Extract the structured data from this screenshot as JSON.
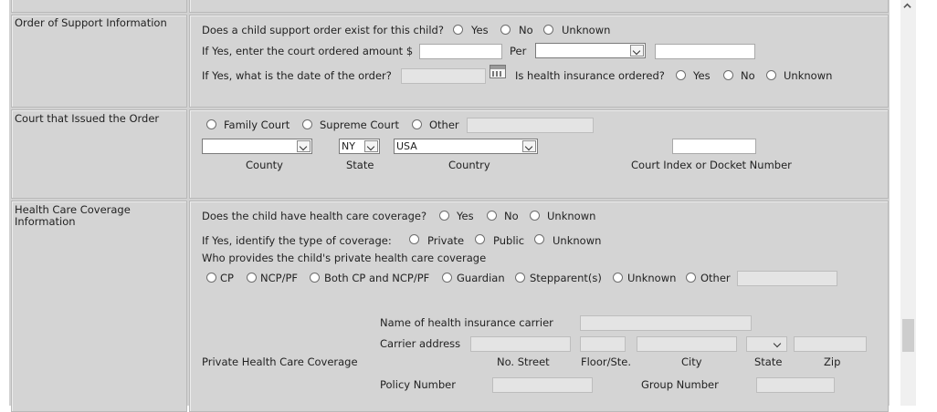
{
  "sections": {
    "order_of_support": {
      "title": "Order of Support Information",
      "q_order_exists": "Does a child support order exist for this child?",
      "yes": "Yes",
      "no": "No",
      "unknown": "Unknown",
      "q_amount": "If Yes, enter the court ordered amount $",
      "per_label": "Per",
      "q_date": "If Yes, what is the date of the order?",
      "q_health_ordered": "Is health insurance ordered?"
    },
    "court": {
      "title": "Court that Issued the Order",
      "family_court": "Family Court",
      "supreme_court": "Supreme Court",
      "other": "Other",
      "state_value": "NY",
      "country_value": "USA",
      "county_caption": "County",
      "state_caption": "State",
      "country_caption": "Country",
      "docket_caption": "Court Index or Docket Number"
    },
    "health_care": {
      "title_line1": "Health Care Coverage",
      "title_line2": "Information",
      "q_has_coverage": "Does the child have health care coverage?",
      "yes": "Yes",
      "no": "No",
      "unknown": "Unknown",
      "q_type": "If Yes, identify the type of coverage:",
      "private": "Private",
      "public": "Public",
      "q_provider": "Who provides the child's private health care coverage",
      "providers": [
        "CP",
        "NCP/PF",
        "Both CP and NCP/PF",
        "Guardian",
        "Stepparent(s)",
        "Unknown",
        "Other"
      ],
      "private_coverage_label": "Private Health Care Coverage",
      "carrier_name_label": "Name of health insurance carrier",
      "carrier_address_label": "Carrier address",
      "street_caption": "No. Street",
      "floor_caption": "Floor/Ste.",
      "city_caption": "City",
      "state_caption": "State",
      "zip_caption": "Zip",
      "policy_label": "Policy Number",
      "group_label": "Group Number"
    }
  }
}
